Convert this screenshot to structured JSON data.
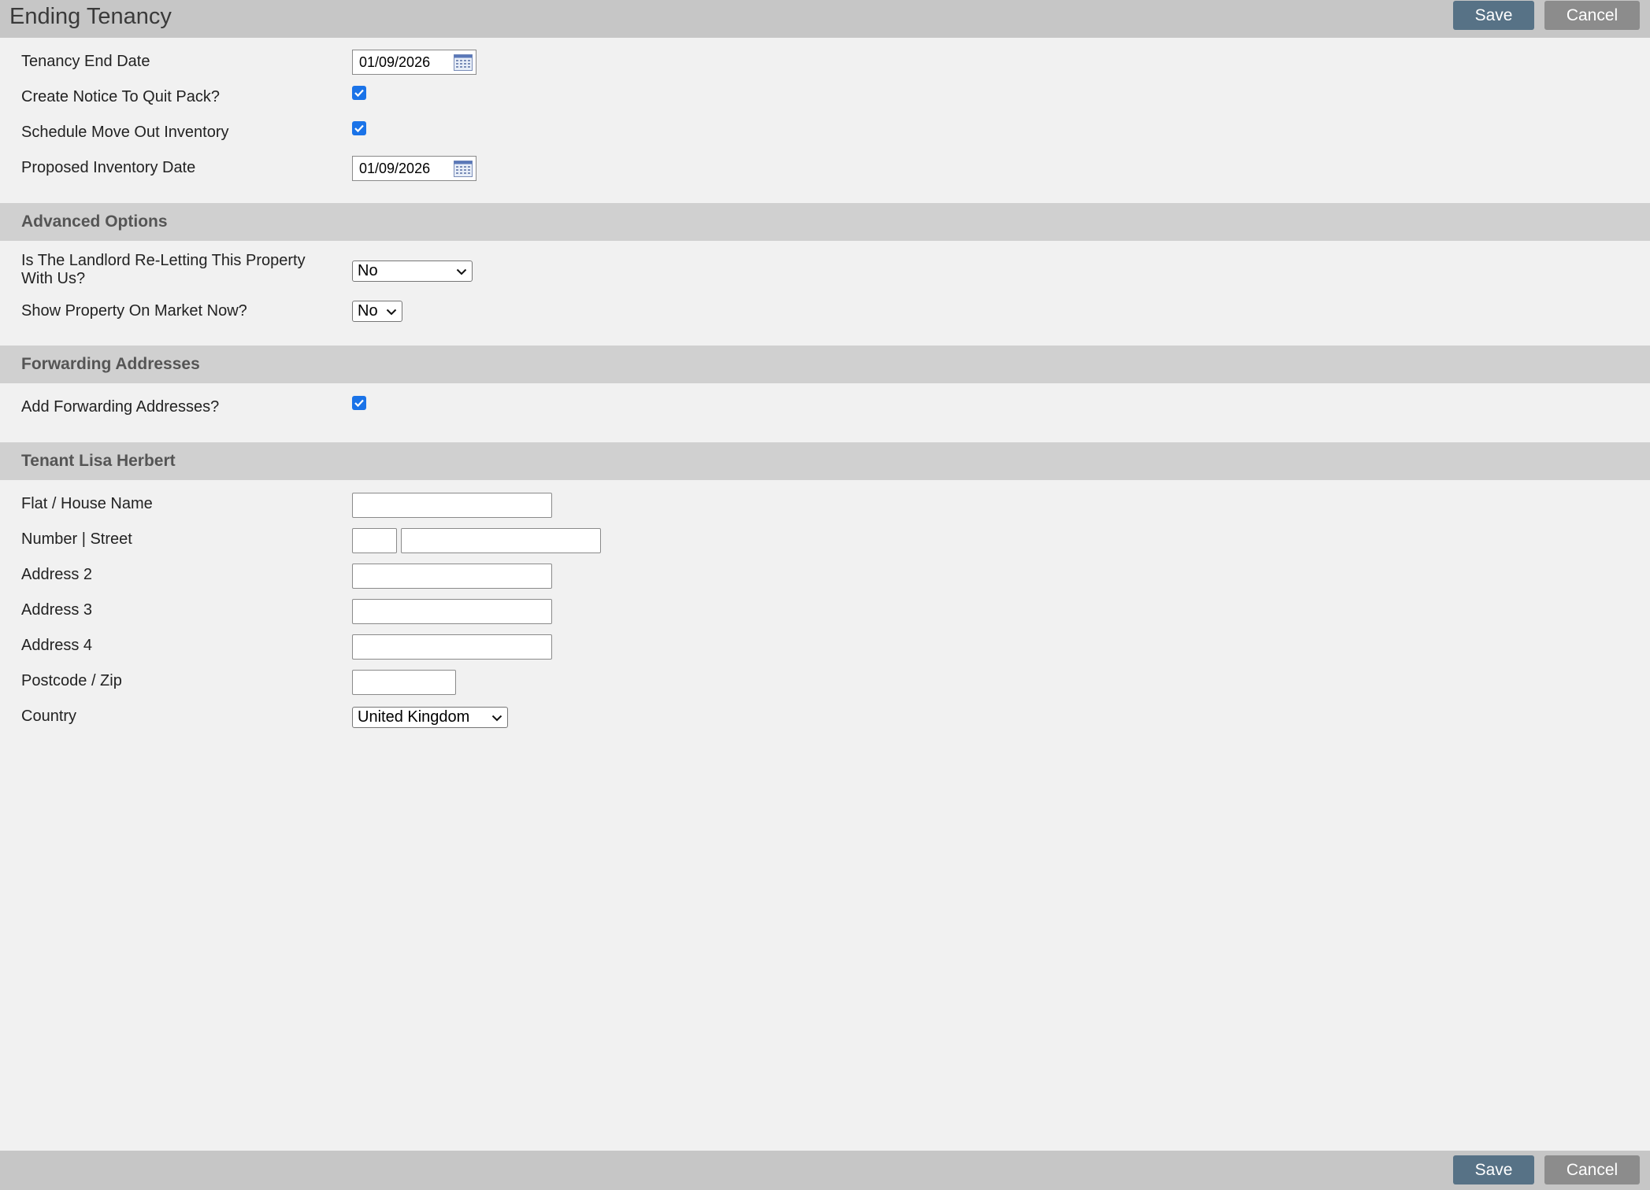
{
  "header": {
    "title": "Ending Tenancy",
    "save_label": "Save",
    "cancel_label": "Cancel"
  },
  "footer": {
    "save_label": "Save",
    "cancel_label": "Cancel"
  },
  "main": {
    "tenancy_end_date": {
      "label": "Tenancy End Date",
      "value": "01/09/2026"
    },
    "create_notice": {
      "label": "Create Notice To Quit Pack?",
      "checked": true
    },
    "schedule_inventory": {
      "label": "Schedule Move Out Inventory",
      "checked": true
    },
    "proposed_inventory_date": {
      "label": "Proposed Inventory Date",
      "value": "01/09/2026"
    }
  },
  "advanced_options": {
    "heading": "Advanced Options",
    "reletting": {
      "label_line1": "Is The Landlord Re-Letting This Property",
      "label_line2": "With Us?",
      "value": "No"
    },
    "show_on_market": {
      "label": "Show Property On Market Now?",
      "value": "No"
    }
  },
  "forwarding_addresses": {
    "heading": "Forwarding Addresses",
    "add_forwarding": {
      "label": "Add Forwarding Addresses?",
      "checked": true
    }
  },
  "tenant": {
    "heading": "Tenant Lisa Herbert",
    "fields": {
      "flat_house_name": {
        "label": "Flat / House Name",
        "value": ""
      },
      "number_street": {
        "label": "Number | Street",
        "number": "",
        "street": ""
      },
      "address2": {
        "label": "Address 2",
        "value": ""
      },
      "address3": {
        "label": "Address 3",
        "value": ""
      },
      "address4": {
        "label": "Address 4",
        "value": ""
      },
      "postcode": {
        "label": "Postcode / Zip",
        "value": ""
      },
      "country": {
        "label": "Country",
        "value": "United Kingdom"
      }
    }
  },
  "colors": {
    "save_button": "#577286",
    "cancel_button": "#8c8c8c",
    "checkbox": "#1a73e8",
    "section_header": "#d0d0d0",
    "topbar": "#c6c6c6"
  }
}
